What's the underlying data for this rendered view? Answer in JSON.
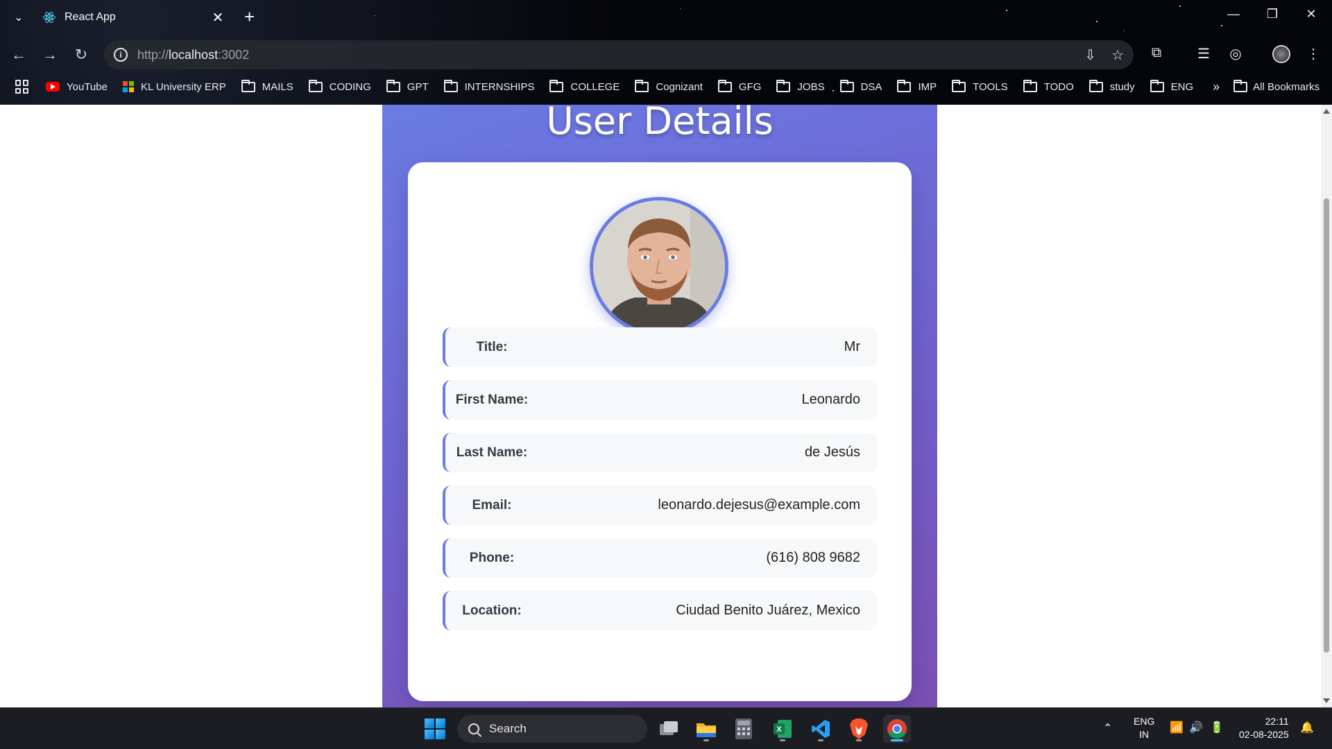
{
  "browser": {
    "tab_title": "React App",
    "url_scheme": "http://",
    "url_host": "localhost",
    "url_port": ":3002"
  },
  "bookmarks": {
    "items": [
      "YouTube",
      "KL University ERP",
      "MAILS",
      "CODING",
      "GPT",
      "INTERNSHIPS",
      "COLLEGE",
      "Cognizant",
      "GFG",
      "JOBS",
      "DSA",
      "IMP",
      "TOOLS",
      "TODO",
      "study",
      "ENG"
    ],
    "all_label": "All Bookmarks"
  },
  "page": {
    "heading": "User Details",
    "fields": [
      {
        "label": "Title:",
        "value": "Mr"
      },
      {
        "label": "First Name:",
        "value": "Leonardo"
      },
      {
        "label": "Last Name:",
        "value": "de Jesús"
      },
      {
        "label": "Email:",
        "value": "leonardo.dejesus@example.com"
      },
      {
        "label": "Phone:",
        "value": "(616) 808 9682"
      },
      {
        "label": "Location:",
        "value": "Ciudad Benito Juárez, Mexico"
      }
    ]
  },
  "taskbar": {
    "search_label": "Search",
    "lang_top": "ENG",
    "lang_bottom": "IN",
    "time": "22:11",
    "date": "02-08-2025"
  },
  "colors": {
    "accent": "#6a7be4",
    "gradient_end": "#7a4fb4"
  }
}
